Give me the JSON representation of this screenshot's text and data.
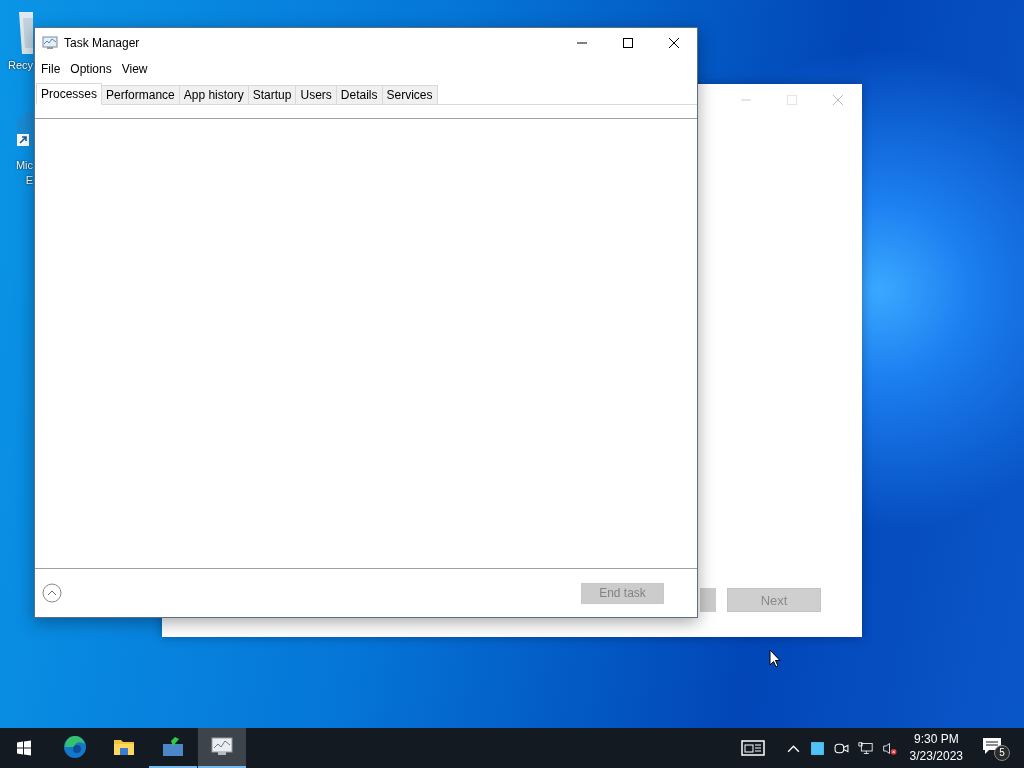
{
  "desktop": {
    "icons": [
      {
        "kind": "recycle",
        "lines": [
          "Recy"
        ]
      },
      {
        "kind": "edge",
        "lines": [
          "Mic",
          "E"
        ]
      }
    ]
  },
  "background_window": {
    "buttons": [
      {
        "label": "Next",
        "disabled": true
      }
    ]
  },
  "task_manager": {
    "title": "Task Manager",
    "menu": [
      "File",
      "Options",
      "View"
    ],
    "tabs": [
      {
        "label": "Processes",
        "selected": true
      },
      {
        "label": "Performance",
        "selected": false
      },
      {
        "label": "App history",
        "selected": false
      },
      {
        "label": "Startup",
        "selected": false
      },
      {
        "label": "Users",
        "selected": false
      },
      {
        "label": "Details",
        "selected": false
      },
      {
        "label": "Services",
        "selected": false
      }
    ],
    "end_task_button": {
      "label": "End task",
      "disabled": true
    }
  },
  "taskbar": {
    "apps": [
      {
        "kind": "edge",
        "running": false,
        "active": false
      },
      {
        "kind": "explorer",
        "running": false,
        "active": false
      },
      {
        "kind": "installer",
        "running": true,
        "active": false
      },
      {
        "kind": "taskmgr",
        "running": true,
        "active": true
      }
    ],
    "clock": {
      "time": "9:30 PM",
      "date": "3/23/2023"
    },
    "notifications": {
      "count": "5"
    }
  }
}
